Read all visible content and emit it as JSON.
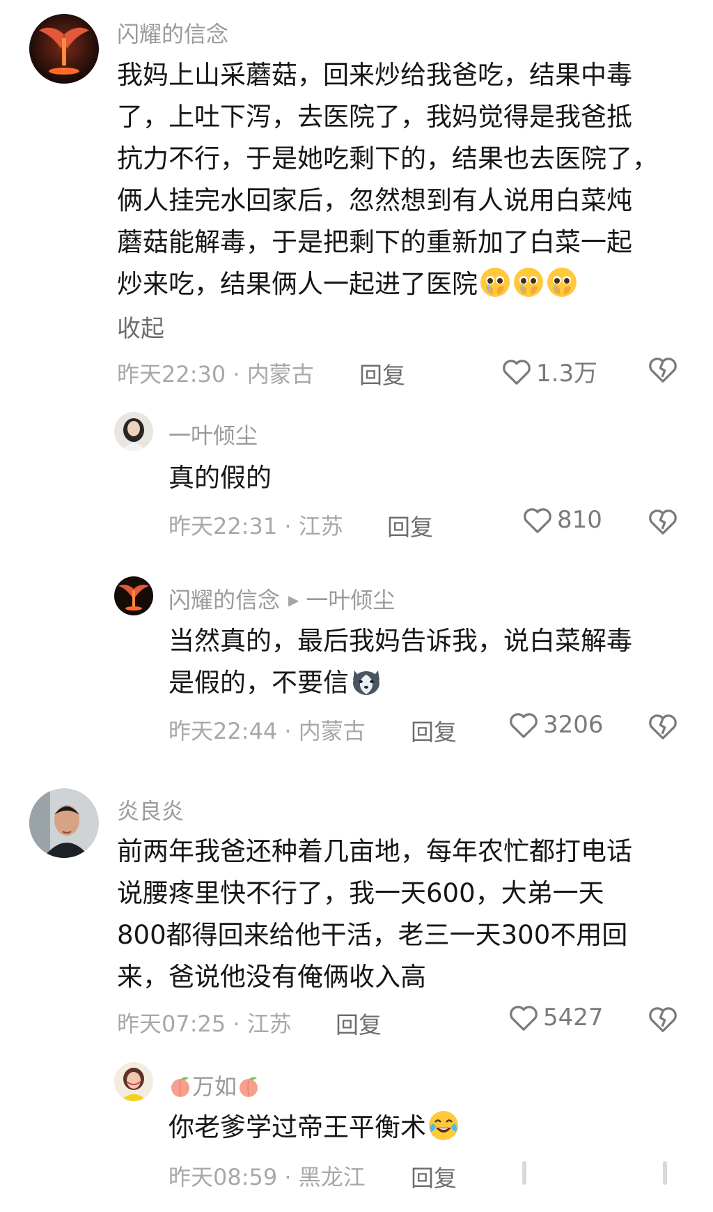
{
  "comments": [
    {
      "username": "闪耀的信念",
      "lines": [
        "我妈上山采蘑菇，回来炒给我爸吃，结果中毒",
        "了，上吐下泻，去医院了，我妈觉得是我爸抵",
        "抗力不行，于是她吃剩下的，结果也去医院了，",
        "俩人挂完水回家后，忽然想到有人说用白菜炖",
        "蘑菇能解毒，于是把剩下的重新加了白菜一起",
        "炒来吃，结果俩人一起进了医院"
      ],
      "collapse_label": "收起",
      "time_location": "昨天22:30 · 内蒙古",
      "reply_label": "回复",
      "likes": "1.3万",
      "replies": [
        {
          "username": "一叶倾尘",
          "text": "真的假的",
          "time_location": "昨天22:31 · 江苏",
          "reply_label": "回复",
          "likes": "810"
        },
        {
          "username": "闪耀的信念",
          "reply_to": "一叶倾尘",
          "lines": [
            "当然真的，最后我妈告诉我，说白菜解毒",
            "是假的，不要信"
          ],
          "time_location": "昨天22:44 · 内蒙古",
          "reply_label": "回复",
          "likes": "3206"
        }
      ]
    },
    {
      "username": "炎良炎",
      "lines": [
        "前两年我爸还种着几亩地，每年农忙都打电话",
        "说腰疼里快不行了，我一天600，大弟一天",
        "800都得回来给他干活，老三一天300不用回",
        "来，爸说他没有俺俩收入高"
      ],
      "time_location": "昨天07:25 · 江苏",
      "reply_label": "回复",
      "likes": "5427",
      "replies": [
        {
          "username": "万如",
          "text": "你老爹学过帝王平衡术",
          "time_location": "昨天08:59 · 黑龙江",
          "reply_label": "回复"
        }
      ]
    }
  ],
  "icons": {
    "like": "heart-outline-icon",
    "dislike": "broken-heart-icon",
    "emoji_1": "pleading-face-icon",
    "emoji_2": "husky-dog-face-icon",
    "emoji_3": "crying-laughing-face-icon",
    "name_decoration": "peach-icon"
  },
  "colors": {
    "text": "#161616",
    "secondary": "#9a9a9a",
    "action": "#6e6e6e"
  }
}
